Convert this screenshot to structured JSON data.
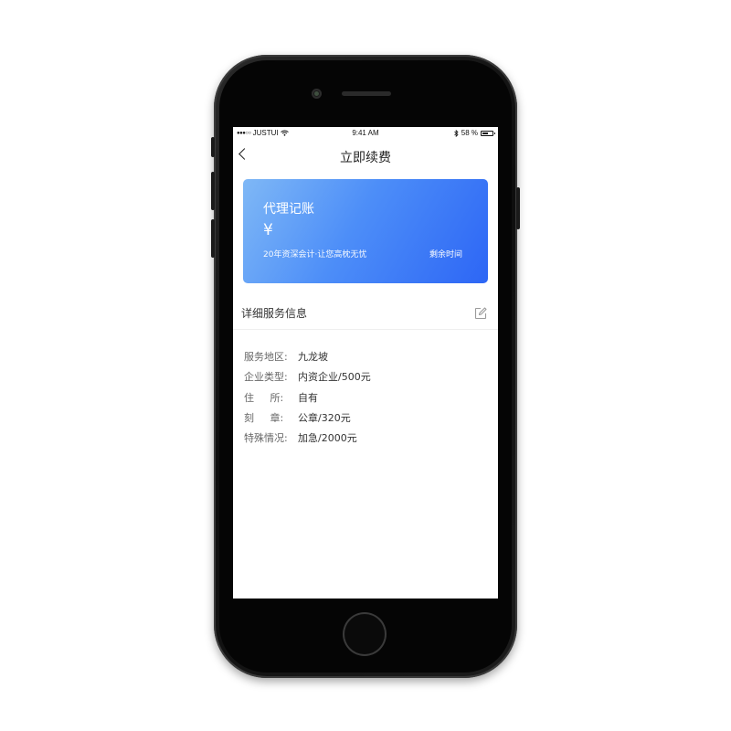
{
  "status_bar": {
    "carrier": "JUSTUI",
    "signal_dots": "●●●○○",
    "time": "9:41 AM",
    "battery_text": "58 %"
  },
  "nav": {
    "title": "立即续费"
  },
  "card": {
    "title": "代理记账",
    "currency": "¥",
    "subtitle": "20年资深会计·让您高枕无忧",
    "remaining": "剩余时间"
  },
  "section": {
    "title": "详细服务信息"
  },
  "info": [
    {
      "label": "服务地区:",
      "value": "九龙坡"
    },
    {
      "label": "企业类型:",
      "value": "内资企业/500元"
    },
    {
      "label": "住     所:",
      "value": "自有"
    },
    {
      "label": "刻     章:",
      "value": "公章/320元"
    },
    {
      "label": "特殊情况:",
      "value": "加急/2000元"
    }
  ],
  "icons": {
    "back": "back-chevron-icon",
    "edit": "edit-icon",
    "wifi": "wifi-icon",
    "bluetooth": "bluetooth-icon",
    "battery": "battery-icon"
  },
  "colors": {
    "card_gradient_start": "#7fb8f6",
    "card_gradient_end": "#2d66f5",
    "phone_body": "#111111"
  }
}
